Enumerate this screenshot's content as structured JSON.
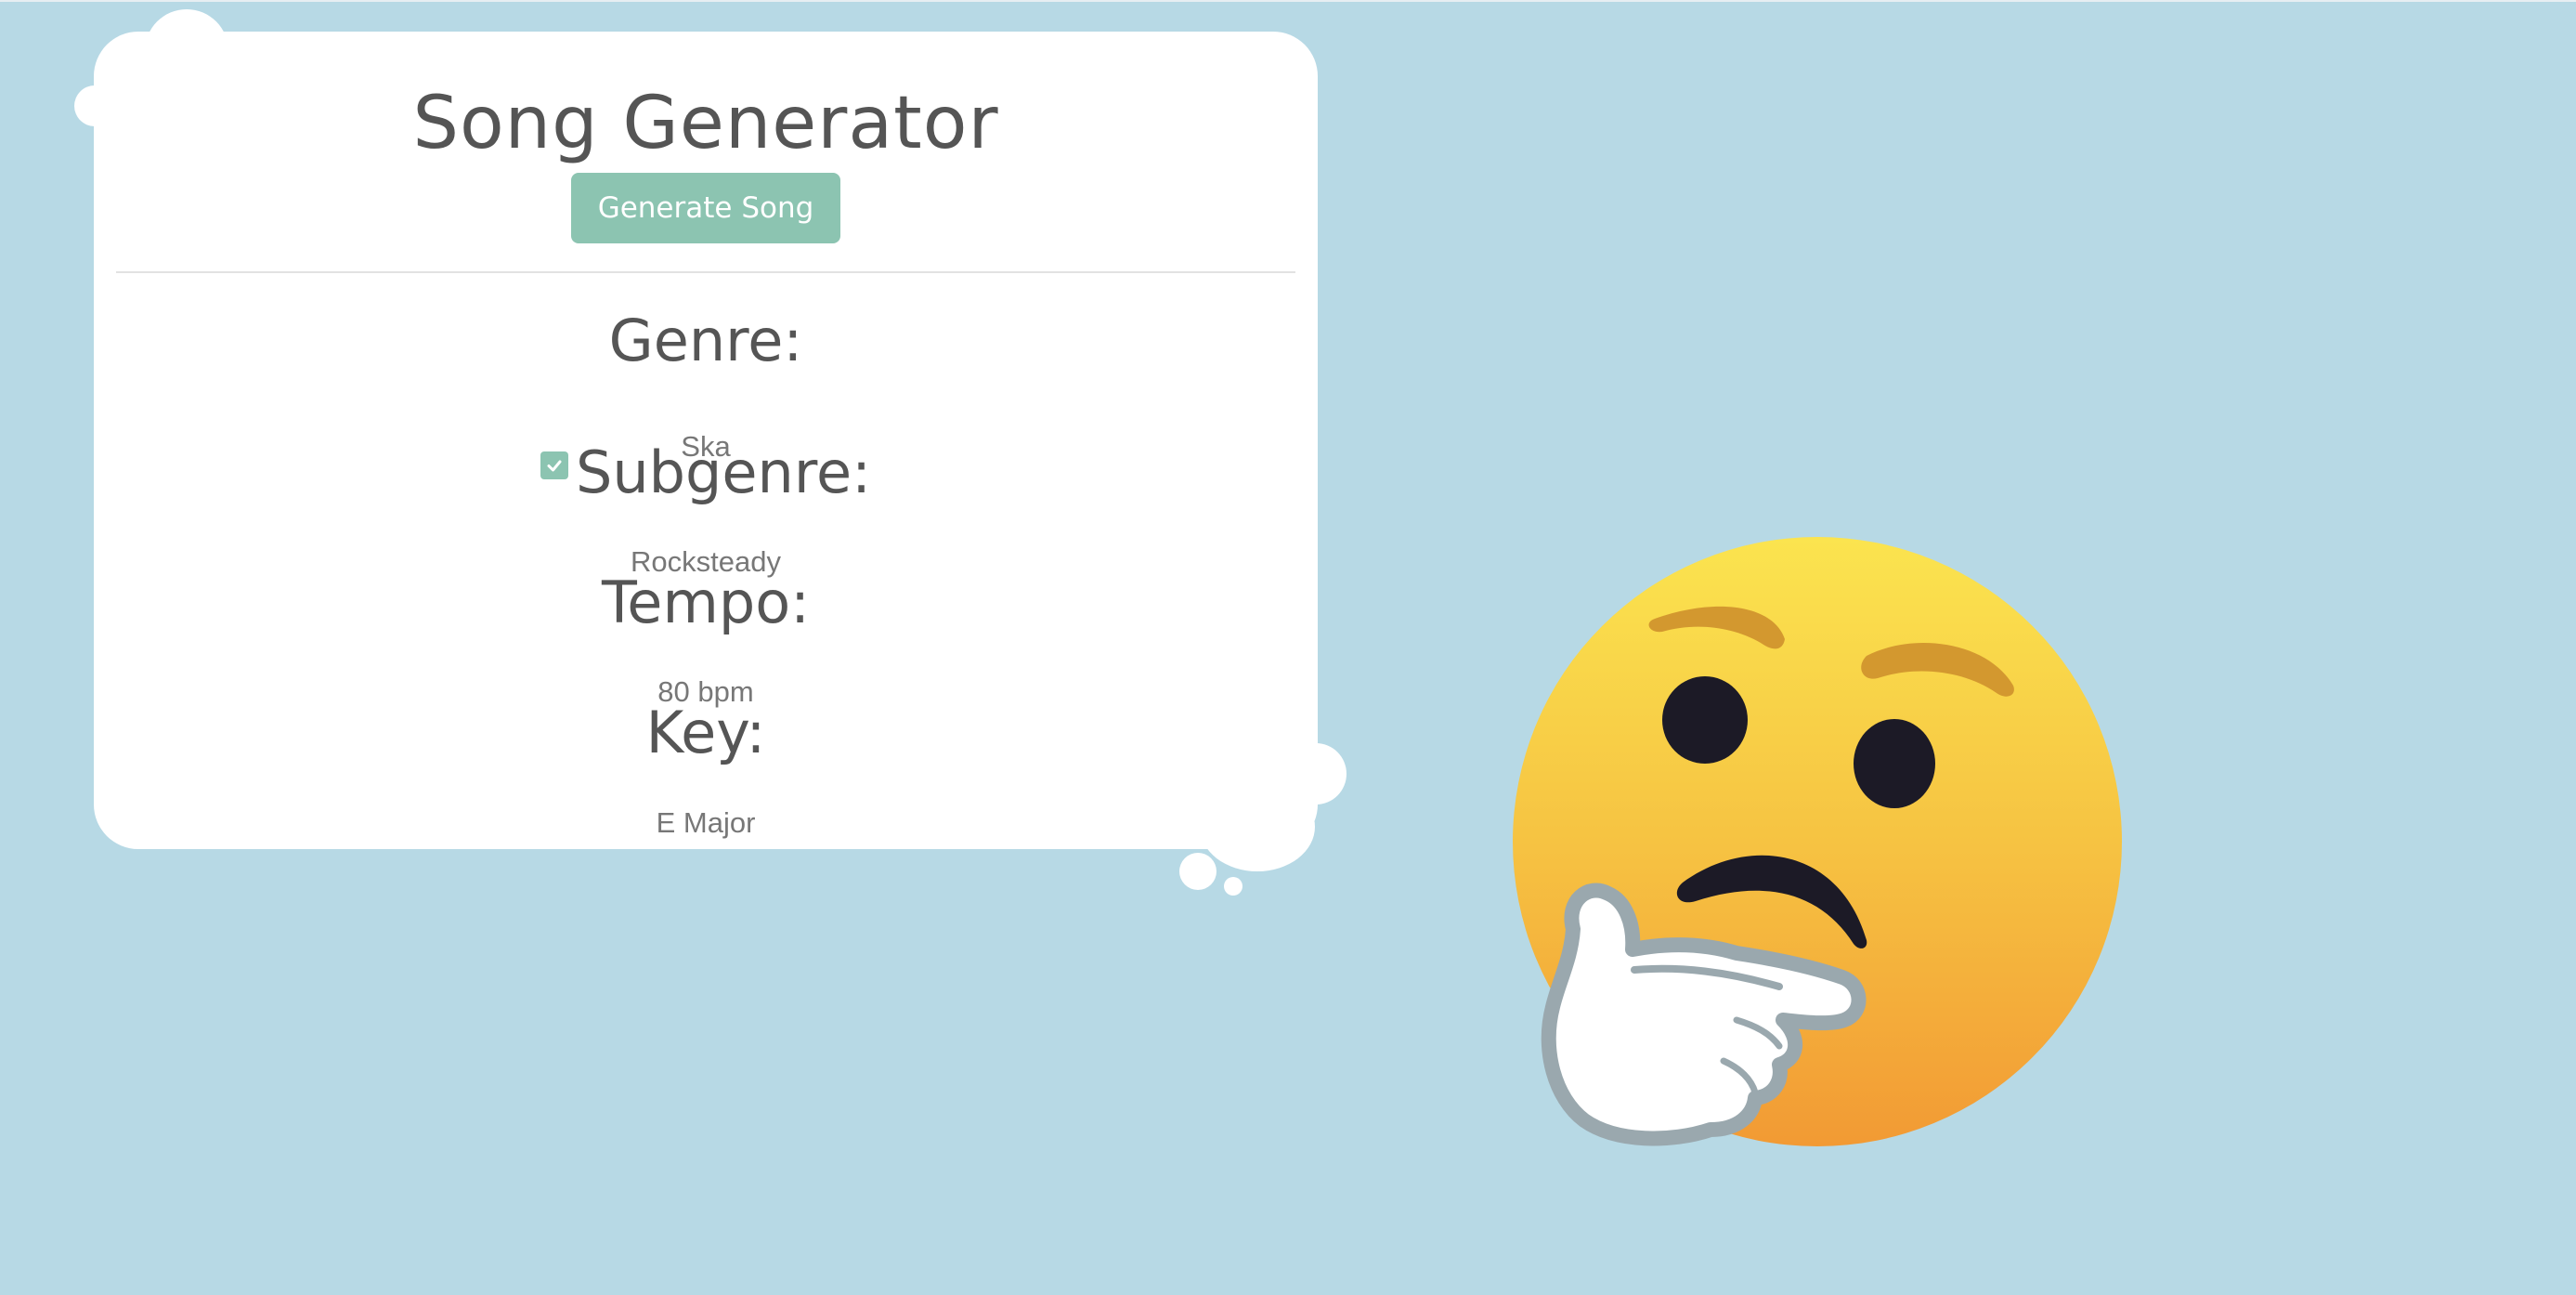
{
  "app": {
    "title": "Song Generator",
    "generate_button_label": "Generate Song"
  },
  "fields": {
    "genre": {
      "label": "Genre:",
      "value": "Ska"
    },
    "subgenre": {
      "label": "Subgenre:",
      "value": "Rocksteady",
      "checked": true
    },
    "tempo": {
      "label": "Tempo:",
      "value": "80 bpm"
    },
    "key": {
      "label": "Key:",
      "value": "E Major"
    }
  },
  "illustration": {
    "icon": "thinking-face-icon"
  },
  "colors": {
    "background": "#b7d9e5",
    "card": "#ffffff",
    "accent": "#8cc4b1",
    "heading_text": "#555555",
    "value_text": "#777777"
  }
}
